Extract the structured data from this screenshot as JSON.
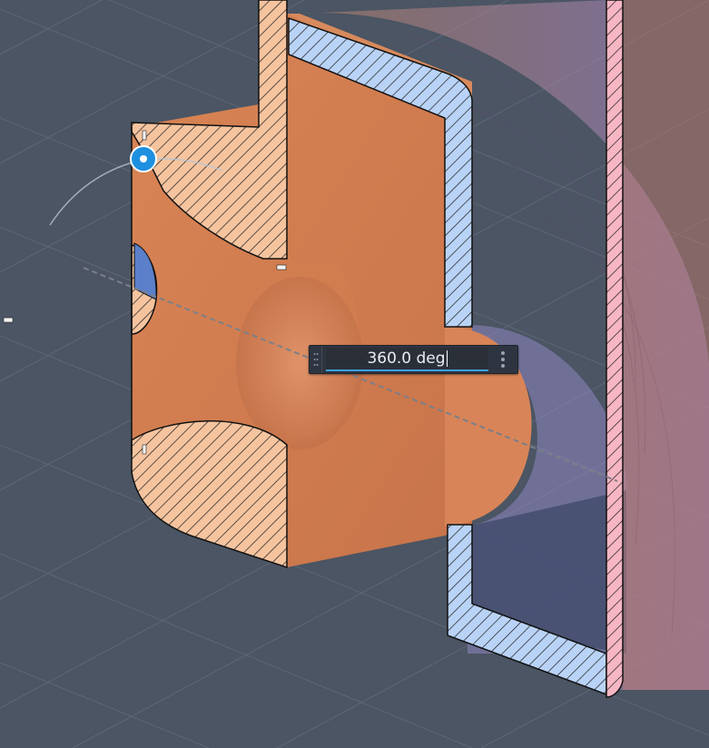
{
  "viewport": {
    "background_color": "#4b5563",
    "grid_color": "#6b7587",
    "body_color": "#d07a4c",
    "hatch_section_orange": "#f5c49f",
    "hatch_section_blue": "#b9d3f6",
    "hatch_section_pink": "#f6b6c4",
    "ghost_preview_color": "#9a84c8"
  },
  "rotate_manipulator": {
    "handle_icon": "rotate-handle-icon",
    "accent_color": "#1e90e0"
  },
  "value_input": {
    "value": "360.0 deg",
    "grip_icon": "grip-dots-icon",
    "menu_icon": "more-vertical-icon"
  }
}
